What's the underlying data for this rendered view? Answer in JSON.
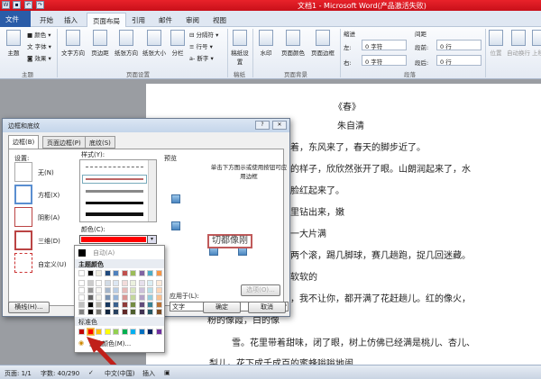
{
  "window": {
    "title": "文档1 - Microsoft Word(产品激活失败)"
  },
  "tabs": [
    "文件",
    "开始",
    "插入",
    "页面布局",
    "引用",
    "邮件",
    "审阅",
    "视图"
  ],
  "active_tab": "页面布局",
  "ribbon": {
    "theme": {
      "main": "主题",
      "colors": "颜色",
      "fonts": "字体",
      "effects": "效果",
      "group": "主题"
    },
    "page_setup": {
      "text_dir": "文字方向",
      "margins": "页边距",
      "orientation": "纸张方向",
      "size": "纸张大小",
      "columns": "分栏",
      "breaks": "分隔符",
      "line_numbers": "行号",
      "hyphenation": "断字",
      "group": "页面设置"
    },
    "manuscript": {
      "label": "稿纸设置",
      "group": "稿纸"
    },
    "background": {
      "watermark": "水印",
      "page_color": "页面颜色",
      "page_borders": "页面边框",
      "group": "页面背景"
    },
    "paragraph": {
      "indent": "缩进",
      "left": "左:",
      "right": "右:",
      "left_val": "0 字符",
      "right_val": "0 字符",
      "spacing": "间距",
      "before": "段前:",
      "after": "段后:",
      "before_val": "0 行",
      "after_val": "0 行",
      "group": "段落"
    },
    "arrange": {
      "position": "位置",
      "wrap": "自动换行",
      "forward": "上移"
    }
  },
  "document": {
    "lines": [
      "《春》",
      "朱自清",
      "着，东风来了，春天的脚步近了。",
      "的样子，欣欣然张开了眼。山朗润起来了，水",
      "脸红起来了。",
      "里钻出来，嫩",
      "一大片满",
      "两个滚，踢几脚球，赛几趟跑，捉几回迷藏。",
      "软软的",
      "，我不让你，都开满了花赶趟儿。红的像火，",
      "粉的像霞，白的像",
      "雪。花里带着甜味，闭了眼，树上仿佛已经满是桃儿、杏儿、",
      "梨儿。花下成千成百的蜜蜂嗡嗡地闹"
    ]
  },
  "dialog": {
    "title": "边框和底纹",
    "tabs": [
      "边框(B)",
      "页面边框(P)",
      "底纹(S)"
    ],
    "settings_label": "设置:",
    "settings": [
      "无(N)",
      "方框(X)",
      "阴影(A)",
      "三维(D)",
      "自定义(U)"
    ],
    "style_label": "样式(Y):",
    "color_label": "颜色(C):",
    "selected_color": "#ff0000",
    "preview_label": "预览",
    "preview_hint": "单击下方图示或使用按钮可应用边框",
    "preview_text": "切都像刚",
    "apply_label": "应用于(L):",
    "apply_value": "文字",
    "options": "选项(O)...",
    "hline": "横线(H)...",
    "ok": "确定",
    "cancel": "取消"
  },
  "palette": {
    "auto": "自动(A)",
    "theme_label": "主题颜色",
    "standard_label": "标准色",
    "more": "其他颜色(M)...",
    "theme_colors": [
      "#ffffff",
      "#000000",
      "#eeece1",
      "#1f497d",
      "#4f81bd",
      "#c0504d",
      "#9bbb59",
      "#8064a2",
      "#4bacc6",
      "#f79646"
    ],
    "standard_colors": [
      "#c00000",
      "#ff0000",
      "#ffc000",
      "#ffff00",
      "#92d050",
      "#00b050",
      "#00b0f0",
      "#0070c0",
      "#002060",
      "#7030a0"
    ]
  },
  "status": {
    "page": "页面: 1/1",
    "words": "字数: 40/290",
    "lang": "中文(中国)",
    "mode": "插入"
  }
}
